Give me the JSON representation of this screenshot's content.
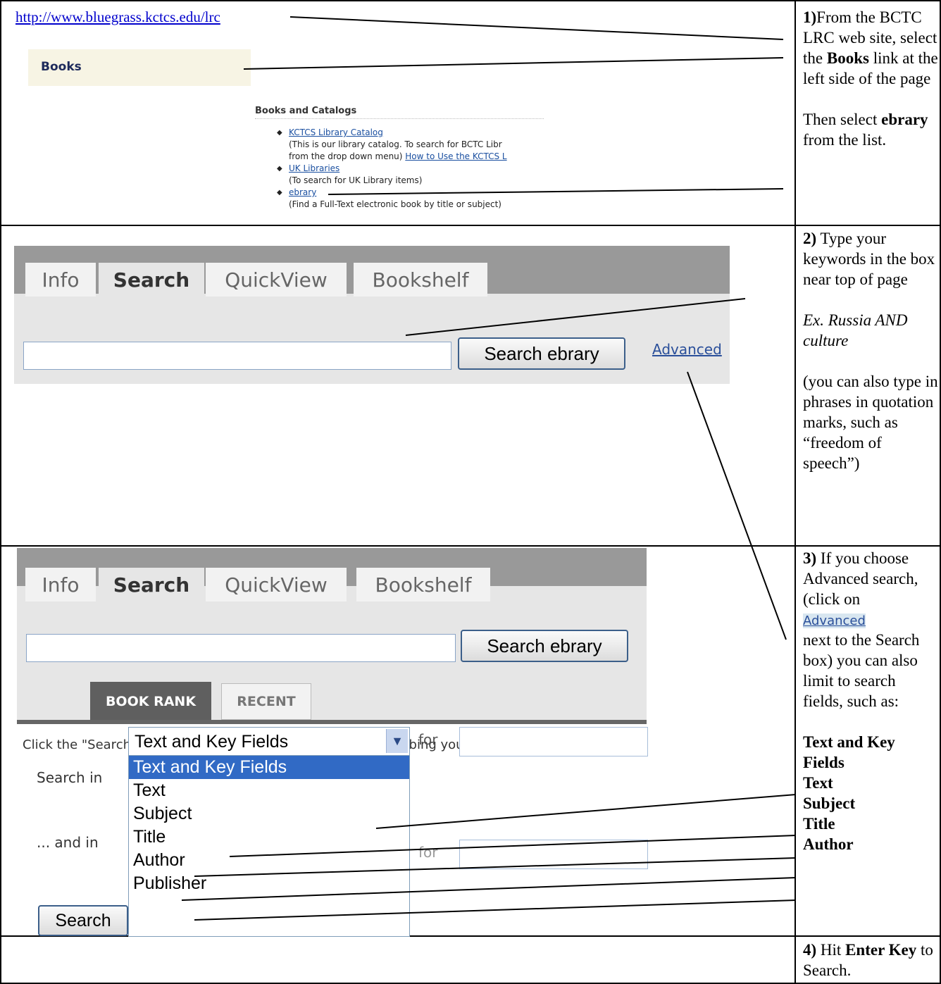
{
  "row1": {
    "url_link": "http://www.bluegrass.kctcs.edu/lrc",
    "books_label": "Books",
    "books_catalogs_heading": "Books and Catalogs",
    "list": [
      {
        "link": "KCTCS Library Catalog",
        "desc": "(This is our library catalog. To search for BCTC Libr",
        "desc2_prefix": "from the drop down menu) ",
        "desc2_link": "How to Use the KCTCS L"
      },
      {
        "link": "UK Libraries",
        "desc": "(To search for UK Library items)"
      },
      {
        "link": "ebrary",
        "desc": "(Find a Full-Text electronic book by title or subject)"
      }
    ],
    "note": {
      "step": "1)",
      "text1": "From the BCTC LRC web site, select the ",
      "bold1": "Books",
      "text2": " link at the left side of the page",
      "text3": "Then select ",
      "bold2": "ebrary",
      "text4": " from the list."
    }
  },
  "row2": {
    "tabs": [
      "Info",
      "Search",
      "QuickView",
      "Bookshelf"
    ],
    "search_button": "Search ebrary",
    "advanced_link": "Advanced",
    "note": {
      "step": "2)",
      "text1": " Type your keywords in the box near top of page",
      "example": "Ex. Russia AND culture",
      "text2": "(you can also type in phrases in quotation marks, such as “freedom of speech”)"
    }
  },
  "row3": {
    "tabs": [
      "Info",
      "Search",
      "QuickView",
      "Bookshelf"
    ],
    "search_button": "Search ebrary",
    "subtabs": [
      "BOOK RANK",
      "RECENT"
    ],
    "hint": "Click the \"Search ebrary\" button when you've finished describing your search.",
    "search_in_label": "Search in",
    "and_in_label": "... and in",
    "for_label": "for",
    "selected_value": "Text and Key Fields",
    "options": [
      "Text and Key Fields",
      "Text",
      "Subject",
      "Title",
      "Author",
      "Publisher"
    ],
    "search_button2": "Search",
    "note": {
      "step": "3)",
      "text1": "  If you choose Advanced search, (click on",
      "advanced_chip": "Advanced",
      "text2": "next to the Search box) you can also limit to search fields, such as:",
      "fields": [
        "Text and Key Fields",
        "Text",
        "Subject",
        "Title",
        "Author"
      ]
    }
  },
  "row4": {
    "note": {
      "step": "4)",
      "text1": " Hit ",
      "bold1": "Enter Key",
      "text2": " to Search."
    }
  }
}
